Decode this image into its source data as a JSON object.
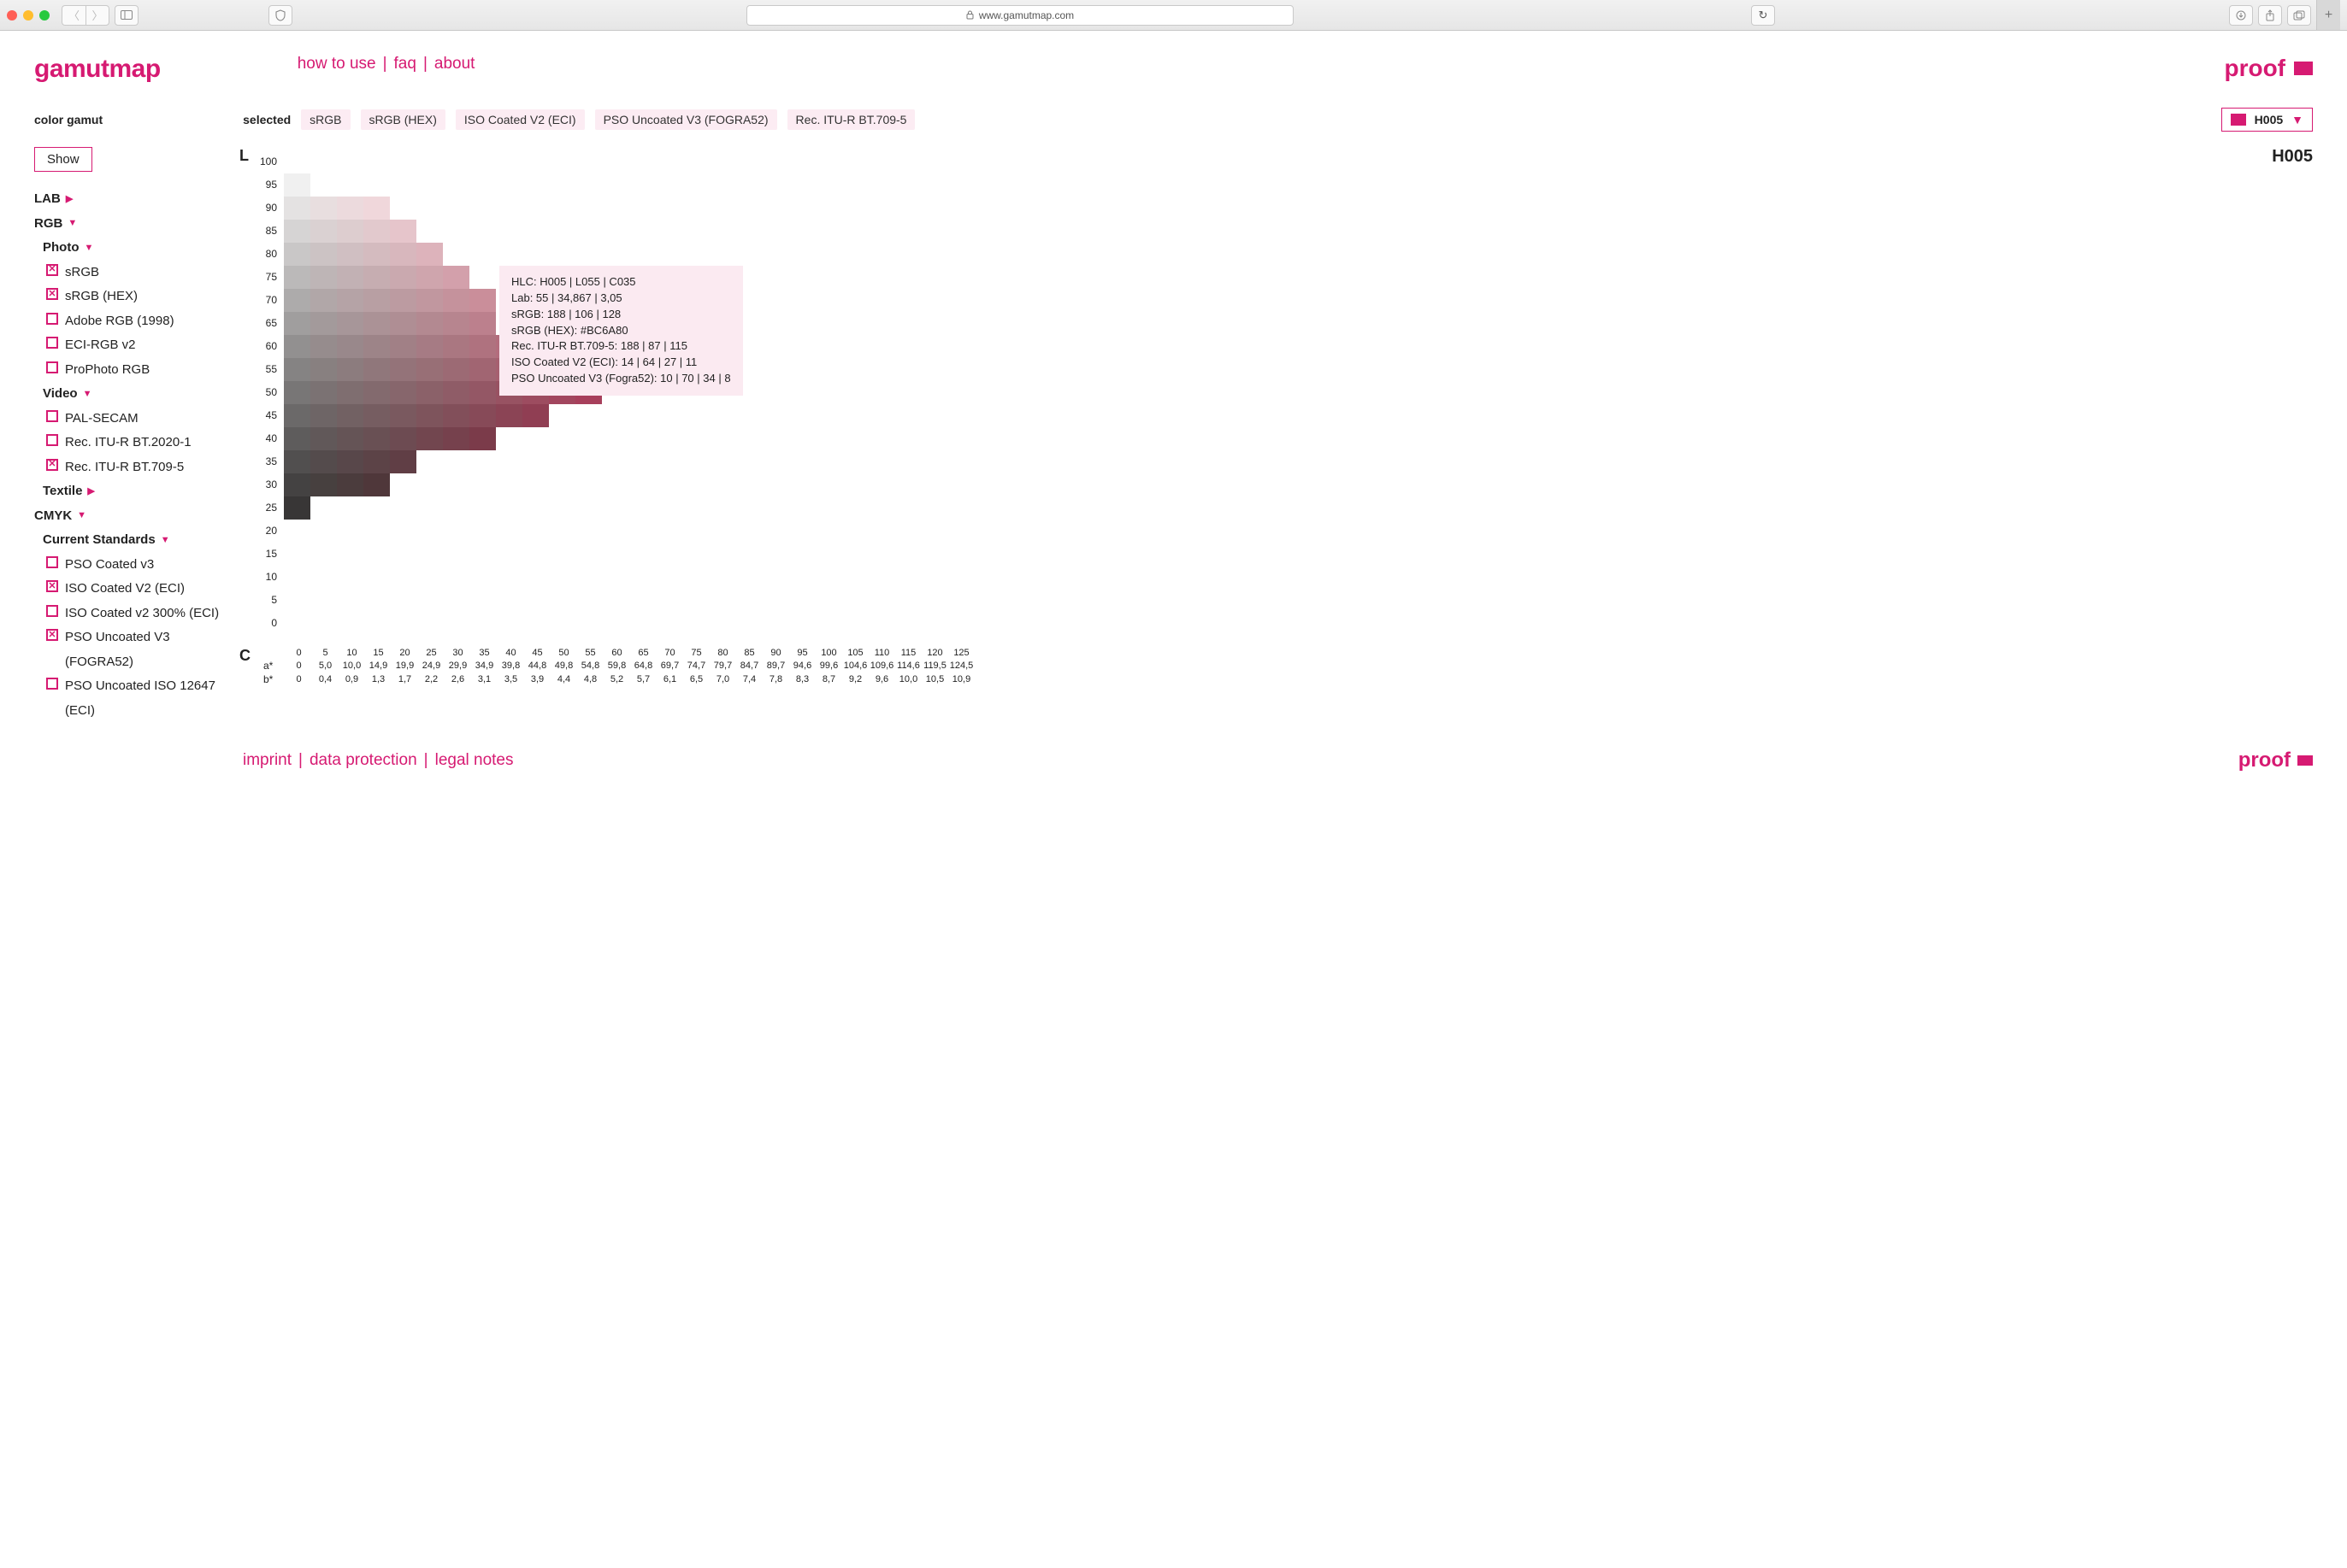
{
  "browser": {
    "url": "www.gamutmap.com"
  },
  "brand": "gamutmap",
  "topnav": {
    "how": "how to use",
    "faq": "faq",
    "about": "about"
  },
  "proof": "proof",
  "sidebar_title": "color gamut",
  "show": "Show",
  "selected_label": "selected",
  "selected": [
    "sRGB",
    "sRGB (HEX)",
    "ISO Coated V2 (ECI)",
    "PSO Uncoated V3 (FOGRA52)",
    "Rec. ITU-R BT.709-5"
  ],
  "hue_select": "H005",
  "hue_title": "H005",
  "tree": {
    "lab": "LAB",
    "rgb": "RGB",
    "photo": "Photo",
    "photo_items": [
      {
        "label": "sRGB",
        "on": true
      },
      {
        "label": "sRGB (HEX)",
        "on": true
      },
      {
        "label": "Adobe RGB (1998)",
        "on": false
      },
      {
        "label": "ECI-RGB v2",
        "on": false
      },
      {
        "label": "ProPhoto RGB",
        "on": false
      }
    ],
    "video": "Video",
    "video_items": [
      {
        "label": "PAL-SECAM",
        "on": false
      },
      {
        "label": "Rec. ITU-R BT.2020-1",
        "on": false
      },
      {
        "label": "Rec. ITU-R BT.709-5",
        "on": true
      }
    ],
    "textile": "Textile",
    "cmyk": "CMYK",
    "cs": "Current Standards",
    "cs_items": [
      {
        "label": "PSO Coated v3",
        "on": false
      },
      {
        "label": "ISO Coated V2 (ECI)",
        "on": true
      },
      {
        "label": "ISO Coated v2 300% (ECI)",
        "on": false
      },
      {
        "label": "PSO Uncoated V3 (FOGRA52)",
        "on": true
      },
      {
        "label": "PSO Uncoated ISO 12647 (ECI)",
        "on": false
      }
    ]
  },
  "tooltip": {
    "l1": "HLC: H005 | L055 | C035",
    "l2": "Lab: 55 | 34,867 | 3,05",
    "l3": "sRGB: 188 | 106 | 128",
    "l4": "sRGB (HEX): #BC6A80",
    "l5": "Rec. ITU-R BT.709-5: 188 | 87 | 115",
    "l6": "ISO Coated V2 (ECI): 14 | 64 | 27 | 11",
    "l7": "PSO Uncoated V3 (Fogra52): 10 | 70 | 34 | 8"
  },
  "footer": {
    "imprint": "imprint",
    "dp": "data protection",
    "legal": "legal notes"
  },
  "chart_data": {
    "type": "heatmap",
    "title": "H005",
    "xlabel": "C",
    "ylabel": "L",
    "y_ticks": [
      100,
      95,
      90,
      85,
      80,
      75,
      70,
      65,
      60,
      55,
      50,
      45,
      40,
      35,
      30,
      25,
      20,
      15,
      10,
      5,
      0
    ],
    "x_C": [
      0,
      5,
      10,
      15,
      20,
      25,
      30,
      35,
      40,
      45,
      50,
      55,
      60,
      65,
      70,
      75,
      80,
      85,
      90,
      95,
      100,
      105,
      110,
      115,
      120,
      125
    ],
    "x_astar": [
      0,
      "5,0",
      "10,0",
      "14,9",
      "19,9",
      "24,9",
      "29,9",
      "34,9",
      "39,8",
      "44,8",
      "49,8",
      "54,8",
      "59,8",
      "64,8",
      "69,7",
      "74,7",
      "79,7",
      "84,7",
      "89,7",
      "94,6",
      "99,6",
      "104,6",
      "109,6",
      "114,6",
      "119,5",
      "124,5"
    ],
    "x_bstar": [
      0,
      "0,4",
      "0,9",
      "1,3",
      "1,7",
      "2,2",
      "2,6",
      "3,1",
      "3,5",
      "3,9",
      "4,4",
      "4,8",
      "5,2",
      "5,7",
      "6,1",
      "6,5",
      "7,0",
      "7,4",
      "7,8",
      "8,3",
      "8,7",
      "9,2",
      "9,6",
      "10,0",
      "10,5",
      "10,9"
    ],
    "rows": [
      {
        "L": 95,
        "colors": [
          "#f0f0f0"
        ]
      },
      {
        "L": 90,
        "colors": [
          "#e4e2e2",
          "#e8dedf",
          "#ecdadd",
          "#f0d7db"
        ]
      },
      {
        "L": 85,
        "colors": [
          "#d6d4d4",
          "#dad1d2",
          "#ddcdcf",
          "#e2c9cd",
          "#e6c5cb"
        ]
      },
      {
        "L": 80,
        "colors": [
          "#c9c7c7",
          "#ccc3c4",
          "#d0bfc2",
          "#d4bbbf",
          "#d8b7bd",
          "#ddb3bb"
        ]
      },
      {
        "L": 75,
        "colors": [
          "#bbb9b9",
          "#beb5b6",
          "#c2b1b4",
          "#c6adb1",
          "#caa9af",
          "#cfa5ad",
          "#d3a0ab"
        ]
      },
      {
        "L": 70,
        "colors": [
          "#adabab",
          "#b1a7a8",
          "#b5a3a6",
          "#b89fa3",
          "#bc9ba1",
          "#c1979f",
          "#c5929c",
          "#ca8e9a"
        ]
      },
      {
        "L": 65,
        "colors": [
          "#a09e9e",
          "#a39a9b",
          "#a79699",
          "#ab9296",
          "#af8e94",
          "#b38991",
          "#b7858f",
          "#bc808d"
        ]
      },
      {
        "L": 60,
        "colors": [
          "#929090",
          "#968c8d",
          "#99888b",
          "#9d8488",
          "#a18086",
          "#a67b84",
          "#aa7781",
          "#af727f",
          "#b36d7d"
        ]
      },
      {
        "L": 55,
        "colors": [
          "#858383",
          "#888080",
          "#8c7c7e",
          "#90777b",
          "#947379",
          "#986f76",
          "#9c6a74",
          "#a16572",
          "#a66070",
          "#aa5b6d"
        ]
      },
      {
        "L": 50,
        "colors": [
          "#787676",
          "#7b7273",
          "#7f6e70",
          "#836a6e",
          "#87666c",
          "#8b6169",
          "#8f5c67",
          "#945765",
          "#985262",
          "#9d4c60",
          "#a2465e",
          "#a73f5b"
        ]
      },
      {
        "L": 45,
        "colors": [
          "#6b6969",
          "#6e6566",
          "#726163",
          "#765d61",
          "#7a595f",
          "#7e545c",
          "#824f5a",
          "#874a58",
          "#8b4455",
          "#903e53"
        ]
      },
      {
        "L": 40,
        "colors": [
          "#5e5c5c",
          "#615859",
          "#655456",
          "#695054",
          "#6d4b52",
          "#72464f",
          "#76414d",
          "#7b3b4a"
        ]
      },
      {
        "L": 35,
        "colors": [
          "#514f4f",
          "#544b4c",
          "#58474a",
          "#5c4347",
          "#603e45"
        ]
      },
      {
        "L": 30,
        "colors": [
          "#444242",
          "#47403f",
          "#4b3c3d",
          "#4f373a"
        ]
      },
      {
        "L": 25,
        "colors": [
          "#383636"
        ]
      }
    ]
  }
}
